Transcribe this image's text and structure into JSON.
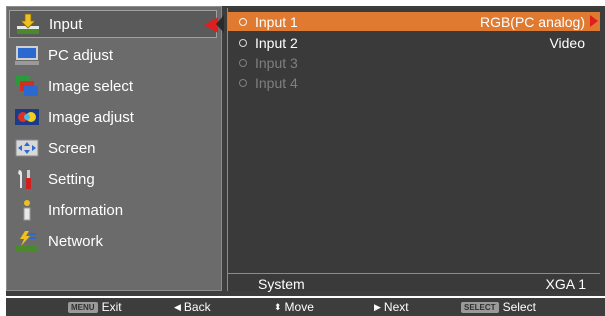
{
  "menu": {
    "items": [
      {
        "label": "Input",
        "icon": "input-icon",
        "selected": true
      },
      {
        "label": "PC adjust",
        "icon": "pc-adjust-icon"
      },
      {
        "label": "Image select",
        "icon": "image-select-icon"
      },
      {
        "label": "Image adjust",
        "icon": "image-adjust-icon"
      },
      {
        "label": "Screen",
        "icon": "screen-icon"
      },
      {
        "label": "Setting",
        "icon": "setting-icon"
      },
      {
        "label": "Information",
        "icon": "information-icon"
      },
      {
        "label": "Network",
        "icon": "network-icon"
      }
    ]
  },
  "inputs": [
    {
      "label": "Input 1",
      "value": "RGB(PC analog)",
      "active": true
    },
    {
      "label": "Input 2",
      "value": "Video"
    },
    {
      "label": "Input 3",
      "value": "",
      "disabled": true
    },
    {
      "label": "Input 4",
      "value": "",
      "disabled": true
    }
  ],
  "system": {
    "label": "System",
    "value": "XGA 1"
  },
  "footer": {
    "exit_key": "MENU",
    "exit_label": "Exit",
    "back_label": "Back",
    "move_label": "Move",
    "next_label": "Next",
    "select_key": "SELECT",
    "select_label": "Select"
  },
  "colors": {
    "highlight": "#e07a30",
    "arrow": "#e01e1e",
    "panel": "#3a3a3a",
    "menu_bg": "#6b6b6b"
  }
}
